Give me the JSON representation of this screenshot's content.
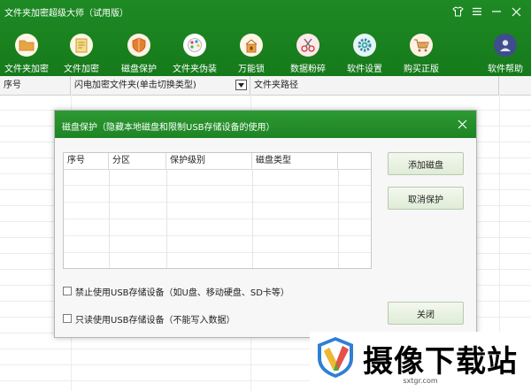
{
  "window": {
    "title": "文件夹加密超级大师（试用版）",
    "controls": {
      "skin": "skin",
      "menu": "menu",
      "minimize": "minimize",
      "close": "close"
    }
  },
  "toolbar": {
    "items": [
      {
        "label": "文件夹加密",
        "icon": "folder-icon",
        "color": "#e8a545"
      },
      {
        "label": "文件加密",
        "icon": "document-icon",
        "color": "#e8c46a"
      },
      {
        "label": "磁盘保护",
        "icon": "shield-icon",
        "color": "#e57f2b"
      },
      {
        "label": "文件夹伪装",
        "icon": "palette-icon",
        "color": "#f0f0f0"
      },
      {
        "label": "万能锁",
        "icon": "lock-icon",
        "color": "#e8a545"
      },
      {
        "label": "数据粉碎",
        "icon": "scissors-icon",
        "color": "#d84b4b"
      },
      {
        "label": "软件设置",
        "icon": "gear-icon",
        "color": "#43a4b3"
      },
      {
        "label": "购买正版",
        "icon": "cart-icon",
        "color": "#e0a55a"
      },
      {
        "label": "软件帮助",
        "icon": "help-user-icon",
        "color": "#4d5a9a"
      }
    ]
  },
  "list": {
    "columns": {
      "index": "序号",
      "folder": "闪电加密文件夹(单击切换类型)",
      "path": "文件夹路径"
    }
  },
  "dialog": {
    "title": "磁盘保护（隐藏本地磁盘和限制USB存储设备的使用）",
    "table": {
      "columns": [
        "序号",
        "分区",
        "保护级别",
        "磁盘类型"
      ]
    },
    "buttons": {
      "add": "添加磁盘",
      "cancel": "取消保护",
      "close": "关闭"
    },
    "checkboxes": {
      "disable_usb": {
        "label": "禁止使用USB存储设备（如U盘、移动硬盘、SD卡等）",
        "checked": false
      },
      "readonly_usb": {
        "label": "只读使用USB存储设备（不能写入数据）",
        "checked": false
      }
    }
  },
  "watermark": {
    "text": "摄像下载站",
    "url": "sxtgr.com"
  }
}
